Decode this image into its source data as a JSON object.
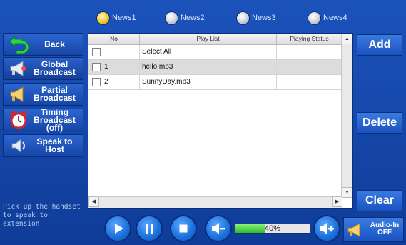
{
  "channels": [
    {
      "label": "News1",
      "selected": true
    },
    {
      "label": "News2",
      "selected": false
    },
    {
      "label": "News3",
      "selected": false
    },
    {
      "label": "News4",
      "selected": false
    }
  ],
  "sidebar": {
    "back": "Back",
    "global": "Global Broadcast",
    "partial": "Partial Broadcast",
    "timing": "Timing Broadcast (off)",
    "speak": "Speak to Host",
    "hint": "Pick up the handset to speak to extension"
  },
  "table": {
    "headers": {
      "no": "No",
      "play_list": "Play List",
      "status": "Playing Status"
    },
    "rows": [
      {
        "no": "",
        "name": "Select All",
        "status": ""
      },
      {
        "no": "1",
        "name": "hello.mp3",
        "status": ""
      },
      {
        "no": "2",
        "name": "SunnyDay.mp3",
        "status": ""
      }
    ]
  },
  "actions": {
    "add": "Add",
    "delete": "Delete",
    "clear": "Clear"
  },
  "volume": {
    "level": 0.4,
    "label": "40%"
  },
  "audio_in": {
    "line1": "Audio-In",
    "line2": "OFF"
  },
  "colors": {
    "background": "#1b53bb",
    "accent": "#f8d140",
    "volume_fill": "#2fbe2a"
  }
}
